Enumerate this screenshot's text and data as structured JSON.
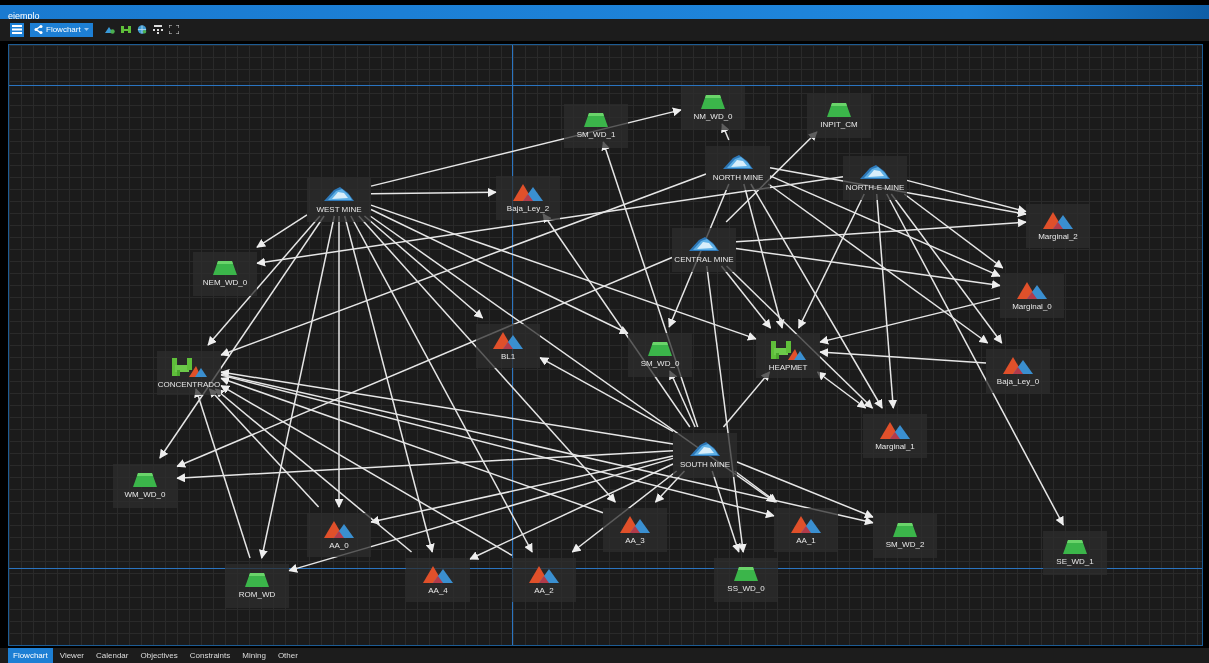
{
  "window": {
    "title": "ejemplo"
  },
  "toolbar": {
    "view_button": "Flowchart"
  },
  "flowchart": {
    "nodes": [
      {
        "label": "NM_WD_0",
        "kind": "dump"
      },
      {
        "label": "SM_WD_1",
        "kind": "dump"
      },
      {
        "label": "INPIT_CM",
        "kind": "dump"
      },
      {
        "label": "NORTH MINE",
        "kind": "mine"
      },
      {
        "label": "NORTH-E MINE",
        "kind": "mine"
      },
      {
        "label": "WEST MINE",
        "kind": "mine"
      },
      {
        "label": "Baja_Ley_2",
        "kind": "stockpile"
      },
      {
        "label": "Marginal_2",
        "kind": "stockpile"
      },
      {
        "label": "CENTRAL MINE",
        "kind": "mine"
      },
      {
        "label": "NEM_WD_0",
        "kind": "dump"
      },
      {
        "label": "Marginal_0",
        "kind": "stockpile"
      },
      {
        "label": "BL1",
        "kind": "stockpile"
      },
      {
        "label": "SM_WD_0",
        "kind": "dump"
      },
      {
        "label": "HEAPMET",
        "kind": "plant"
      },
      {
        "label": "CONCENTRADO",
        "kind": "plant"
      },
      {
        "label": "Baja_Ley_0",
        "kind": "stockpile"
      },
      {
        "label": "Marginal_1",
        "kind": "stockpile"
      },
      {
        "label": "SOUTH MINE",
        "kind": "mine"
      },
      {
        "label": "WM_WD_0",
        "kind": "dump"
      },
      {
        "label": "AA_0",
        "kind": "stockpile"
      },
      {
        "label": "AA_3",
        "kind": "stockpile"
      },
      {
        "label": "AA_1",
        "kind": "stockpile"
      },
      {
        "label": "SM_WD_2",
        "kind": "dump"
      },
      {
        "label": "SE_WD_1",
        "kind": "dump"
      },
      {
        "label": "ROM_WD",
        "kind": "dump"
      },
      {
        "label": "AA_4",
        "kind": "stockpile"
      },
      {
        "label": "AA_2",
        "kind": "stockpile"
      },
      {
        "label": "SS_WD_0",
        "kind": "dump"
      }
    ]
  },
  "tabs": [
    {
      "label": "Flowchart",
      "selected": true
    },
    {
      "label": "Viewer",
      "selected": false
    },
    {
      "label": "Calendar",
      "selected": false
    },
    {
      "label": "Objectives",
      "selected": false
    },
    {
      "label": "Constraints",
      "selected": false
    },
    {
      "label": "Mining",
      "selected": false
    },
    {
      "label": "Other",
      "selected": false
    }
  ]
}
